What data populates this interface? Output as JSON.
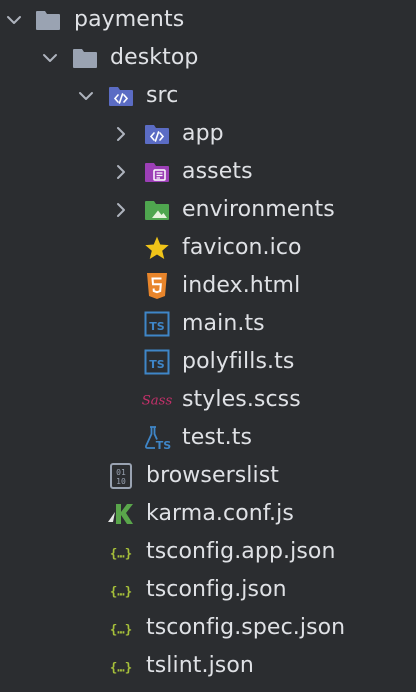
{
  "tree": [
    {
      "label": "payments",
      "icon": "folder-icon",
      "chevron": "expanded"
    },
    {
      "label": "desktop",
      "icon": "folder-icon",
      "chevron": "expanded"
    },
    {
      "label": "src",
      "icon": "source-folder-icon",
      "chevron": "expanded"
    },
    {
      "label": "app",
      "icon": "angular-app-folder-icon",
      "chevron": "collapsed"
    },
    {
      "label": "assets",
      "icon": "resources-folder-icon",
      "chevron": "collapsed"
    },
    {
      "label": "environments",
      "icon": "image-folder-icon",
      "chevron": "collapsed"
    },
    {
      "label": "favicon.ico",
      "icon": "star-icon",
      "chevron": "none"
    },
    {
      "label": "index.html",
      "icon": "html5-icon",
      "chevron": "none"
    },
    {
      "label": "main.ts",
      "icon": "typescript-icon",
      "chevron": "none"
    },
    {
      "label": "polyfills.ts",
      "icon": "typescript-icon",
      "chevron": "none"
    },
    {
      "label": "styles.scss",
      "icon": "sass-icon",
      "chevron": "none"
    },
    {
      "label": "test.ts",
      "icon": "test-typescript-icon",
      "chevron": "none"
    },
    {
      "label": "browserslist",
      "icon": "binary-file-icon",
      "chevron": "none"
    },
    {
      "label": "karma.conf.js",
      "icon": "karma-icon",
      "chevron": "none"
    },
    {
      "label": "tsconfig.app.json",
      "icon": "json-icon",
      "chevron": "none"
    },
    {
      "label": "tsconfig.json",
      "icon": "json-icon",
      "chevron": "none"
    },
    {
      "label": "tsconfig.spec.json",
      "icon": "json-icon",
      "chevron": "none"
    },
    {
      "label": "tslint.json",
      "icon": "json-icon",
      "chevron": "none"
    }
  ],
  "colors": {
    "background": "#2b2d30",
    "text": "#dfe1e5",
    "chevron": "#aeb3bd",
    "folder": "#9aa3b2",
    "source_folder": "#5b6cc4",
    "resources_folder": "#9c3fb6",
    "image_folder": "#4fa64f",
    "typescript": "#3f86c8",
    "html5": "#e8852b",
    "star": "#f0c419",
    "sass": "#c4306a",
    "json": "#a8c23a",
    "karma": "#5aa64b"
  }
}
